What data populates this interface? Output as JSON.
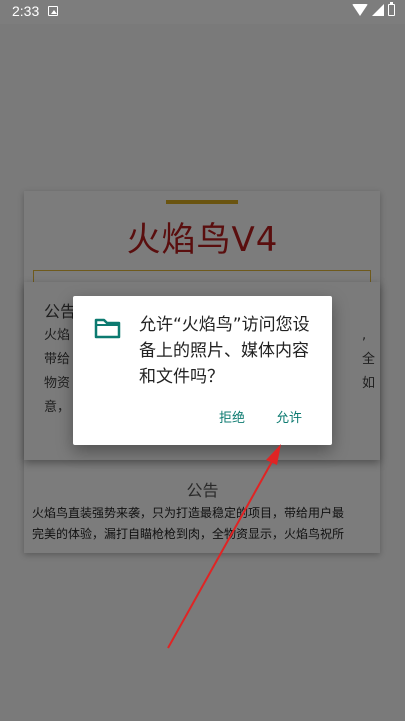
{
  "status_bar": {
    "time": "2:33",
    "icons": [
      "photo-indicator-icon",
      "wifi-icon",
      "signal-icon",
      "battery-icon"
    ]
  },
  "app": {
    "title": "火焰鸟V4",
    "notice": {
      "heading": "公告",
      "lines": [
        "火焰",
        "带给",
        "物资",
        "意，"
      ],
      "right_fragments": [
        ",",
        "全",
        "如"
      ]
    },
    "bottom_notice": {
      "heading": "公告",
      "lines": [
        "火焰鸟直装强势来袭，只为打造最稳定的项目，带给用户最",
        "完美的体验，漏打自瞄枪枪到肉，全物资显示，火焰鸟祝所"
      ]
    }
  },
  "permission_dialog": {
    "icon": "folder-icon",
    "message": "允许“火焰鸟”访问您设备上的照片、媒体内容和文件吗？",
    "deny_label": "拒绝",
    "allow_label": "允许",
    "accent_color": "#0c7a70"
  },
  "annotation": {
    "arrow_color": "#e02424",
    "points_to": "allow-button"
  }
}
